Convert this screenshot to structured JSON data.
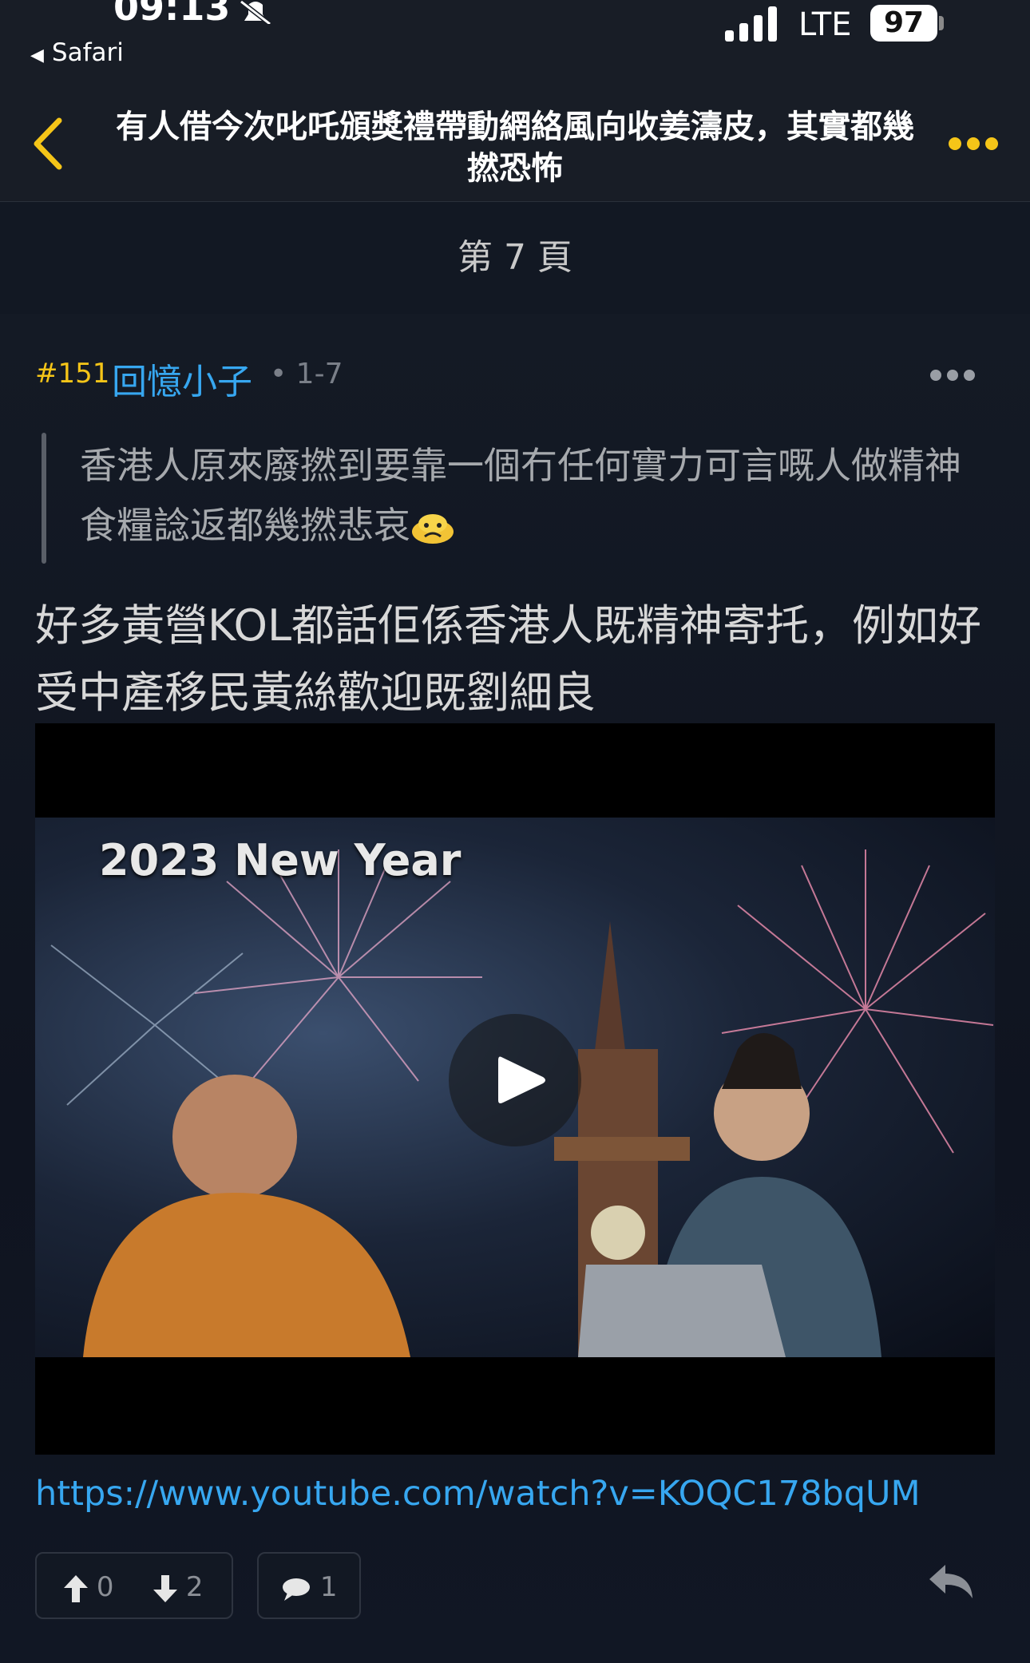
{
  "status_bar": {
    "time": "09:13",
    "back_app": "Safari",
    "network": "LTE",
    "battery": "97"
  },
  "nav": {
    "title": "有人借今次叱吒頒獎禮帶動網絡風向收姜濤皮，其實都幾撚恐怖"
  },
  "page_indicator": "第 7 頁",
  "post": {
    "number": "#151",
    "username": "回憶小子",
    "meta": "• 1-7",
    "quote": "香港人原來廢撚到要靠一個冇任何實力可言嘅人做精神食糧諗返都幾撚悲哀",
    "body": "好多黃營KOL都話佢係香港人既精神寄托，例如好受中產移民黃絲歡迎既劉細良",
    "video_caption": "2023 New Year",
    "link": "https://www.youtube.com/watch?v=KOQC178bqUM",
    "upvotes": "0",
    "downvotes": "2",
    "comments": "1"
  },
  "colors": {
    "accent": "#f5c518",
    "link": "#37a7f0",
    "background": "#0f1520"
  }
}
